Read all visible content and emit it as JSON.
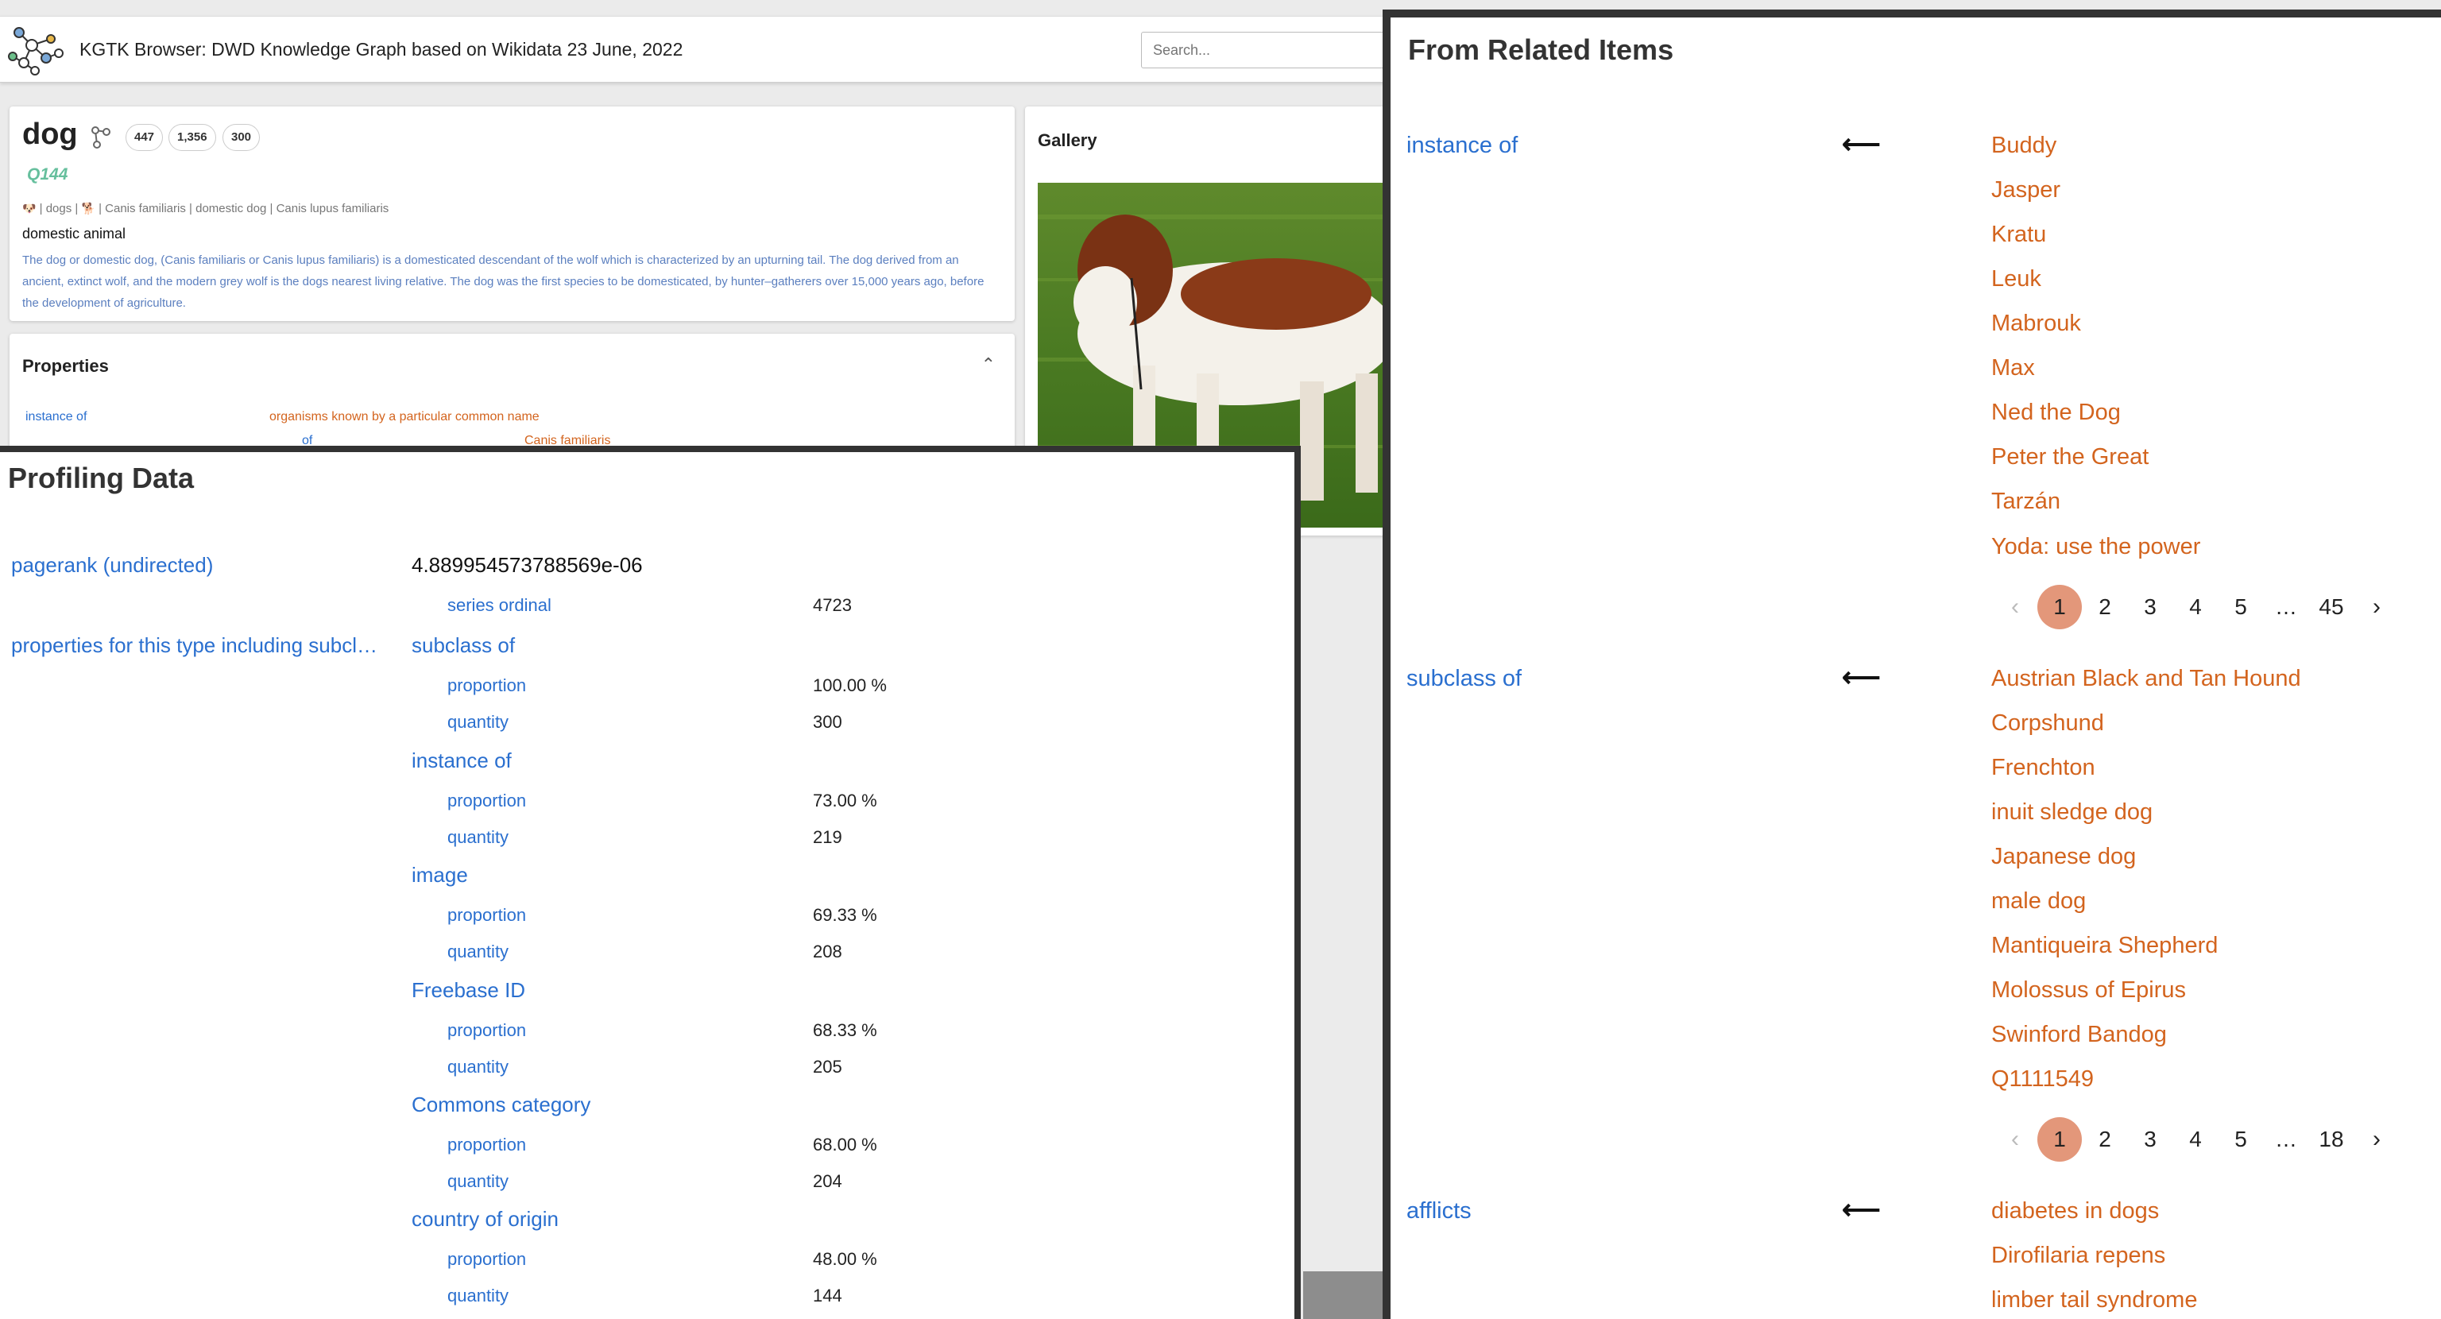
{
  "header": {
    "title": "KGTK Browser: DWD Knowledge Graph based on Wikidata 23 June, 2022",
    "search_placeholder": "Search..."
  },
  "entity": {
    "label": "dog",
    "qnode": "Q144",
    "counts": [
      "447",
      "1,356",
      "300"
    ],
    "aliases": [
      "dogs",
      "Canis familiaris",
      "domestic dog",
      "Canis lupus familiaris"
    ],
    "alias_separator": "|",
    "alias_emojis": [
      "🐶",
      "🐕"
    ],
    "short_description": "domestic animal",
    "long_description": "The dog or domestic dog, (Canis familiaris or Canis lupus familiaris) is a domesticated descendant of the wolf which is characterized by an upturning tail. The dog derived from an ancient, extinct wolf, and the modern grey wolf is the dogs nearest living relative. The dog was the first species to be domesticated, by hunter–gatherers over 15,000 years ago, before the development of agriculture."
  },
  "properties": {
    "title": "Properties",
    "rows": [
      {
        "property": "instance of",
        "value": "organisms known by a particular common name",
        "sub_property": "of",
        "sub_value": "Canis familiaris"
      }
    ]
  },
  "gallery": {
    "title": "Gallery"
  },
  "profiling": {
    "title": "Profiling Data",
    "pagerank_label": "pagerank (undirected)",
    "pagerank_value": "4.889954573788569e-06",
    "series_ordinal_label": "series ordinal",
    "series_ordinal_value": "4723",
    "types_label": "properties for this type including subcl…",
    "property_stats": [
      {
        "name": "subclass of",
        "proportion": "100.00 %",
        "quantity": "300"
      },
      {
        "name": "instance of",
        "proportion": "73.00 %",
        "quantity": "219"
      },
      {
        "name": "image",
        "proportion": "69.33 %",
        "quantity": "208"
      },
      {
        "name": "Freebase ID",
        "proportion": "68.33 %",
        "quantity": "205"
      },
      {
        "name": "Commons category",
        "proportion": "68.00 %",
        "quantity": "204"
      },
      {
        "name": "country of origin",
        "proportion": "48.00 %",
        "quantity": "144"
      }
    ],
    "proportion_label": "proportion",
    "quantity_label": "quantity"
  },
  "related": {
    "title": "From Related Items",
    "arrow": "⟵",
    "groups": [
      {
        "property": "instance of",
        "items": [
          "Buddy",
          "Jasper",
          "Kratu",
          "Leuk",
          "Mabrouk",
          "Max",
          "Ned the Dog",
          "Peter the Great",
          "Tarzán",
          "Yoda: use the power"
        ],
        "pager": {
          "pages": [
            "1",
            "2",
            "3",
            "4",
            "5",
            "…",
            "45"
          ],
          "current": "1"
        }
      },
      {
        "property": "subclass of",
        "items": [
          "Austrian Black and Tan Hound",
          "Corpshund",
          "Frenchton",
          "inuit sledge dog",
          "Japanese dog",
          "male dog",
          "Mantiqueira Shepherd",
          "Molossus of Epirus",
          "Swinford Bandog",
          "Q1111549"
        ],
        "pager": {
          "pages": [
            "1",
            "2",
            "3",
            "4",
            "5",
            "…",
            "18"
          ],
          "current": "1"
        }
      },
      {
        "property": "afflicts",
        "items": [
          "diabetes in dogs",
          "Dirofilaria repens",
          "limber tail syndrome"
        ]
      }
    ]
  },
  "colors": {
    "link_blue": "#2a6fcf",
    "value_orange": "#d3641e",
    "qnode_green": "#66bf9d",
    "pager_active": "#e3977a",
    "panel_border": "#333333"
  }
}
